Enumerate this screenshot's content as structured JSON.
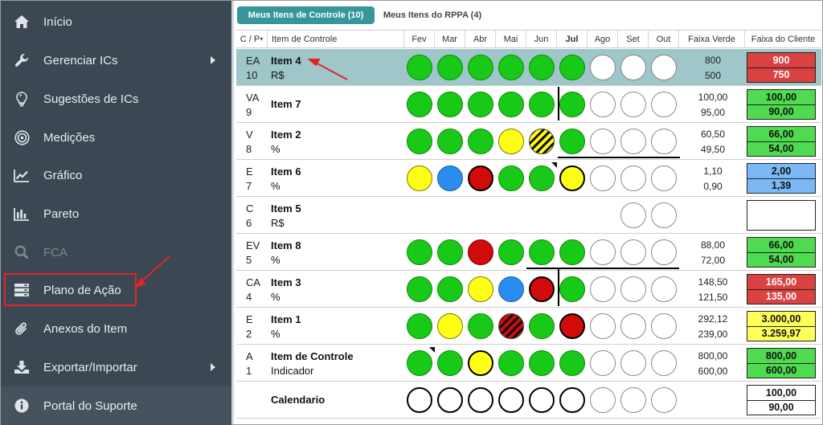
{
  "sidebar": {
    "items": [
      {
        "label": "Início",
        "icon": "home-icon"
      },
      {
        "label": "Gerenciar ICs",
        "icon": "wrench-icon"
      },
      {
        "label": "Sugestões de ICs",
        "icon": "lightbulb-icon"
      },
      {
        "label": "Medições",
        "icon": "target-icon"
      },
      {
        "label": "Gráfico",
        "icon": "line-chart-icon"
      },
      {
        "label": "Pareto",
        "icon": "bar-chart-icon"
      },
      {
        "label": "FCA",
        "icon": "search-icon"
      },
      {
        "label": "Plano de Ação",
        "icon": "server-icon"
      },
      {
        "label": "Anexos do Item",
        "icon": "paperclip-icon"
      },
      {
        "label": "Exportar/Importar",
        "icon": "download-icon"
      },
      {
        "label": "Portal do Suporte",
        "icon": "info-icon"
      }
    ]
  },
  "tabs": {
    "active": "Meus Itens de Controle (10)",
    "inactive": "Meus Itens do RPPA (4)"
  },
  "table": {
    "headers": {
      "cp": "C / P",
      "item": "Item de Controle",
      "months": [
        "Fev",
        "Mar",
        "Abr",
        "Mai",
        "Jun",
        "Jul",
        "Ago",
        "Set",
        "Out"
      ],
      "faixa_verde": "Faixa Verde",
      "faixa_cliente": "Faixa do Cliente"
    },
    "rows": [
      {
        "cp1": "EA",
        "cp2": "10",
        "name": "Item 4",
        "unit": "R$",
        "fv1": "800",
        "fv2": "500",
        "fc1": "900",
        "fc2": "750"
      },
      {
        "cp1": "VA",
        "cp2": "9",
        "name": "Item 7",
        "unit": "",
        "fv1": "100,00",
        "fv2": "95,00",
        "fc1": "100,00",
        "fc2": "90,00"
      },
      {
        "cp1": "V",
        "cp2": "8",
        "name": "Item 2",
        "unit": "%",
        "fv1": "60,50",
        "fv2": "49,50",
        "fc1": "66,00",
        "fc2": "54,00"
      },
      {
        "cp1": "E",
        "cp2": "7",
        "name": "Item 6",
        "unit": "%",
        "fv1": "1,10",
        "fv2": "0,90",
        "fc1": "2,00",
        "fc2": "1,39"
      },
      {
        "cp1": "C",
        "cp2": "6",
        "name": "Item 5",
        "unit": "R$",
        "fv1": "",
        "fv2": "",
        "fc1": "",
        "fc2": ""
      },
      {
        "cp1": "EV",
        "cp2": "5",
        "name": "Item 8",
        "unit": "%",
        "fv1": "88,00",
        "fv2": "72,00",
        "fc1": "66,00",
        "fc2": "54,00"
      },
      {
        "cp1": "CA",
        "cp2": "4",
        "name": "Item 3",
        "unit": "%",
        "fv1": "148,50",
        "fv2": "121,50",
        "fc1": "165,00",
        "fc2": "135,00"
      },
      {
        "cp1": "E",
        "cp2": "2",
        "name": "Item 1",
        "unit": "%",
        "fv1": "292,12",
        "fv2": "239,00",
        "fc1": "3.000,00",
        "fc2": "3.259,97"
      },
      {
        "cp1": "A",
        "cp2": "1",
        "name": "Item de Controle",
        "unit": "Indicador",
        "fv1": "800,00",
        "fv2": "600,00",
        "fc1": "800,00",
        "fc2": "600,00"
      },
      {
        "cp1": "",
        "cp2": "",
        "name": "Calendario",
        "unit": "",
        "fv1": "",
        "fv2": "",
        "fc1": "100,00",
        "fc2": "90,00"
      }
    ],
    "status_legend": {
      "g": "green",
      "y": "yellow",
      "b": "blue",
      "r": "red",
      "e": "empty"
    },
    "statuses": [
      [
        "g",
        "g",
        "g",
        "g",
        "g",
        "g",
        "e",
        "e",
        "e"
      ],
      [
        "g",
        "g",
        "g",
        "g",
        "g",
        "g",
        "e",
        "e",
        "e"
      ],
      [
        "g",
        "g",
        "g",
        "y",
        "hy",
        "g",
        "e",
        "e",
        "e"
      ],
      [
        "y",
        "b",
        "rk",
        "g",
        "gf",
        "yk",
        "e",
        "e",
        "e"
      ],
      [
        "",
        "",
        "",
        "",
        "",
        "",
        "",
        "e",
        "e"
      ],
      [
        "g",
        "g",
        "r",
        "g",
        "g",
        "g",
        "e",
        "e",
        "e"
      ],
      [
        "g",
        "g",
        "y",
        "b",
        "rk",
        "g",
        "e",
        "e",
        "e"
      ],
      [
        "g",
        "y",
        "g",
        "hr",
        "g",
        "rk",
        "e",
        "e",
        "e"
      ],
      [
        "gf",
        "g",
        "yk",
        "g",
        "g",
        "g",
        "e",
        "e",
        "e"
      ],
      [
        "ek",
        "ek",
        "ek",
        "ek",
        "ek",
        "ek",
        "e",
        "e",
        "e"
      ]
    ],
    "client_colors": [
      "red",
      "green",
      "green",
      "blue",
      "white",
      "green",
      "red",
      "yellow",
      "green",
      "white"
    ],
    "colors": {
      "accent": "#36969c",
      "sidebar": "#3b4752",
      "selected_row": "#9fc6c9",
      "annotation": "#e0242b"
    }
  }
}
